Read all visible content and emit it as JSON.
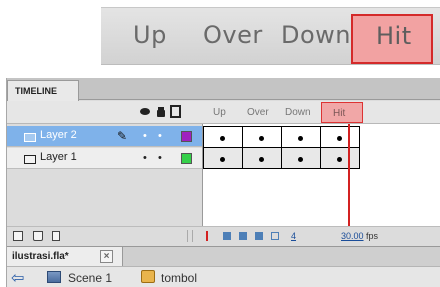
{
  "zoom_header": {
    "labels": [
      "Up",
      "Over",
      "Down"
    ],
    "hit_label": "Hit",
    "hit_color": "#f2a2a2",
    "hit_border_color": "#d42a2a"
  },
  "panel": {
    "title": "TIMELINE"
  },
  "frame_labels": [
    "Up",
    "Over",
    "Down"
  ],
  "hit_label": "Hit",
  "column_icons": [
    "eye-icon",
    "lock-icon",
    "outline-icon"
  ],
  "layers": [
    {
      "name": "Layer 2",
      "selected": true,
      "color": "#a020c0",
      "icon": "layer-icon"
    },
    {
      "name": "Layer 1",
      "selected": false,
      "color": "#35d04a",
      "icon": "layer-icon"
    }
  ],
  "status": {
    "current_frame": "4",
    "fps": "30.00",
    "fps_unit": "fps"
  },
  "document_tab": {
    "name": "ilustrasi.fla*",
    "close": "×"
  },
  "breadcrumb": {
    "back": "⇦",
    "scene": "Scene 1",
    "symbol": "tombol"
  },
  "colors": {
    "selection": "#7fb2ea",
    "playhead": "#d32121"
  }
}
